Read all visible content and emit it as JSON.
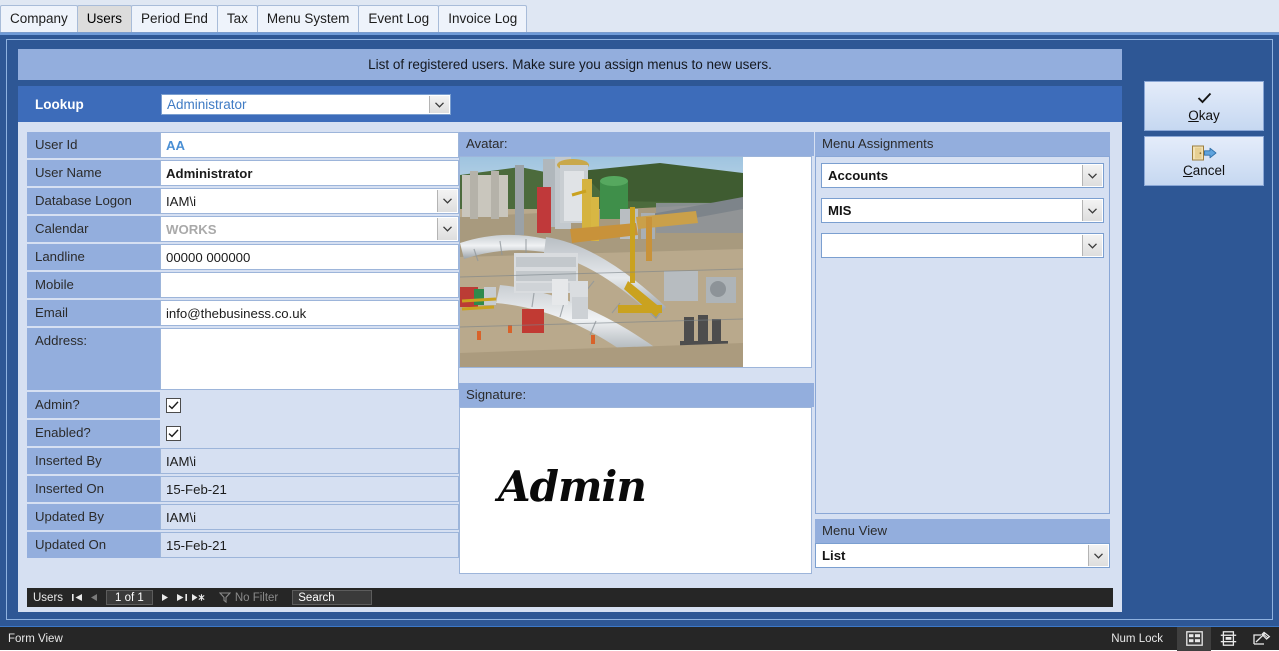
{
  "tabs": [
    {
      "label": "Company",
      "active": false
    },
    {
      "label": "Users",
      "active": true
    },
    {
      "label": "Period End",
      "active": false
    },
    {
      "label": "Tax",
      "active": false
    },
    {
      "label": "Menu System",
      "active": false
    },
    {
      "label": "Event Log",
      "active": false
    },
    {
      "label": "Invoice Log",
      "active": false
    }
  ],
  "banner": {
    "text": "List of registered users. Make sure you assign menus to new users."
  },
  "lookup": {
    "label": "Lookup",
    "value": "Administrator"
  },
  "form": {
    "rows": [
      {
        "label": "User Id",
        "value": "AA",
        "style": "accent",
        "control": "text"
      },
      {
        "label": "User Name",
        "value": "Administrator",
        "style": "bold",
        "control": "text"
      },
      {
        "label": "Database Logon",
        "value": "IAM\\i",
        "style": "normal",
        "control": "combo"
      },
      {
        "label": "Calendar",
        "value": "WORKS",
        "style": "disabled",
        "control": "combo"
      },
      {
        "label": "Landline",
        "value": "00000 000000",
        "style": "normal",
        "control": "text"
      },
      {
        "label": "Mobile",
        "value": "",
        "style": "normal",
        "control": "text"
      },
      {
        "label": "Email",
        "value": "info@thebusiness.co.uk",
        "style": "normal",
        "control": "text"
      },
      {
        "label": "Address:",
        "value": "",
        "style": "normal",
        "control": "textarea"
      },
      {
        "label": "Admin?",
        "value": "",
        "style": "normal",
        "control": "checkbox",
        "checked": true
      },
      {
        "label": "Enabled?",
        "value": "",
        "style": "normal",
        "control": "checkbox",
        "checked": true
      },
      {
        "label": "Inserted By",
        "value": "IAM\\i",
        "style": "readonly",
        "control": "text"
      },
      {
        "label": "Inserted On",
        "value": "15-Feb-21",
        "style": "readonly",
        "control": "text"
      },
      {
        "label": "Updated By",
        "value": "IAM\\i",
        "style": "readonly",
        "control": "text"
      },
      {
        "label": "Updated On",
        "value": "15-Feb-21",
        "style": "readonly",
        "control": "text"
      }
    ]
  },
  "avatar": {
    "label": "Avatar:",
    "image_description": "industrial-processing-plant-photo"
  },
  "signature": {
    "label": "Signature:",
    "text": "Admin"
  },
  "menu_assignments": {
    "heading": "Menu Assignments",
    "items": [
      "Accounts",
      "MIS",
      ""
    ]
  },
  "menu_view": {
    "heading": "Menu View",
    "value": "List"
  },
  "buttons": {
    "okay": {
      "label_pre": "",
      "accel": "O",
      "label_post": "kay",
      "icon": "check-icon"
    },
    "cancel": {
      "label_pre": "",
      "accel": "C",
      "label_post": "ancel",
      "icon": "exit-door-icon"
    }
  },
  "navbar": {
    "record_label": "Users",
    "position": "1 of 1",
    "filter": "No Filter",
    "search_placeholder": "Search"
  },
  "statusbar": {
    "view": "Form View",
    "numlock": "Num Lock",
    "views": [
      {
        "name": "form-view-icon",
        "active": true
      },
      {
        "name": "layout-view-icon",
        "active": false
      },
      {
        "name": "design-view-icon",
        "active": false
      }
    ]
  },
  "colors": {
    "frame_blue": "#2e5795",
    "lookup_blue": "#3d6cba",
    "label_blue": "#93aedd",
    "panel_blue": "#d6e0f2",
    "accent_text": "#4a8fd4"
  }
}
